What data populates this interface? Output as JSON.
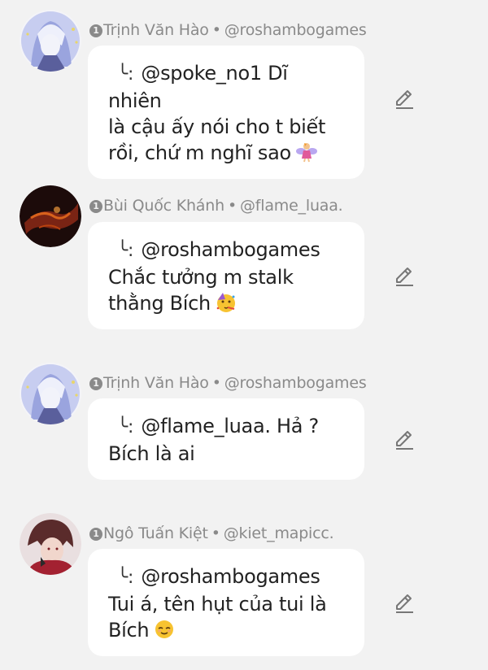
{
  "comments": [
    {
      "badge": "1",
      "name": "Trịnh Văn Hào",
      "separator": "•",
      "handle": "@roshambogames",
      "reply_glyph": "╰:",
      "lines": [
        "@spoke_no1 Dĩ nhiên",
        "là cậu ấy nói cho t biết",
        "rồi, chứ m nghĩ sao"
      ],
      "emoji_icon": "fairy-emoji-icon",
      "avatar_icon": "anime-avatar-icon",
      "avatar_color": "#aab3e6"
    },
    {
      "badge": "1",
      "name": "Bùi Quốc Khánh",
      "separator": "•",
      "handle": "@flame_luaa.",
      "reply_glyph": "╰:",
      "lines": [
        "@roshambogames",
        "Chắc tưởng m stalk",
        "thằng Bích"
      ],
      "emoji_icon": "party-face-emoji-icon",
      "avatar_icon": "dark-avatar-icon",
      "avatar_color": "#2a0f0c"
    },
    {
      "badge": "1",
      "name": "Trịnh Văn Hào",
      "separator": "•",
      "handle": "@roshambogames",
      "reply_glyph": "╰:",
      "lines": [
        "@flame_luaa. Hả ?",
        "Bích là ai"
      ],
      "emoji_icon": "",
      "avatar_icon": "anime-avatar-icon",
      "avatar_color": "#aab3e6"
    },
    {
      "badge": "1",
      "name": "Ngô Tuấn Kiệt",
      "separator": "•",
      "handle": "@kiet_mapicc.",
      "reply_glyph": "╰:",
      "lines": [
        "@roshambogames",
        "Tui á, tên hụt của tui là",
        "Bích"
      ],
      "emoji_icon": "relieved-face-emoji-icon",
      "avatar_icon": "red-anime-avatar-icon",
      "avatar_color": "#8e2a33"
    }
  ],
  "edit_icon": "pencil-edit-icon"
}
